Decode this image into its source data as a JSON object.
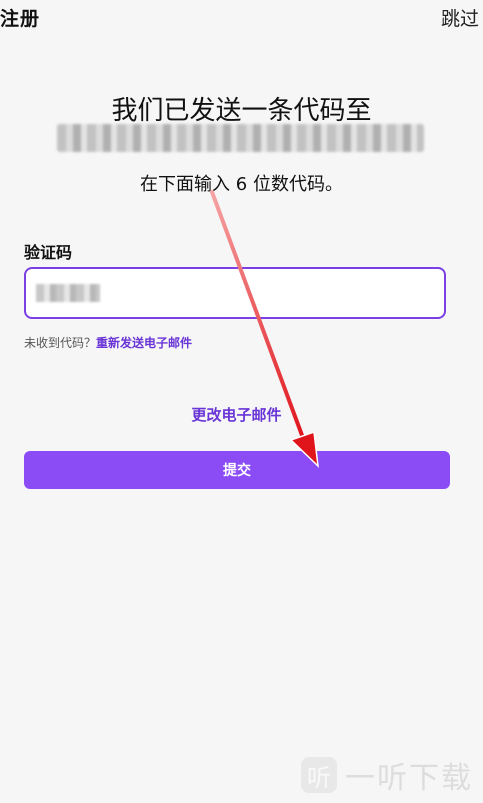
{
  "header": {
    "title": "注册",
    "skip_label": "跳过"
  },
  "verify": {
    "headline": "我们已发送一条代码至",
    "instruction": "在下面输入 6 位数代码。",
    "code_label": "验证码",
    "resend_prompt": "未收到代码？",
    "resend_link": "重新发送电子邮件",
    "change_email": "更改电子邮件",
    "submit_label": "提交"
  },
  "colors": {
    "accent": "#8b4cf6",
    "link": "#6a35d6",
    "input_border": "#7b3fe4",
    "arrow": "#e0141b",
    "background": "#f6f6f7"
  },
  "watermark": {
    "icon": "听",
    "text": "一听下载"
  }
}
